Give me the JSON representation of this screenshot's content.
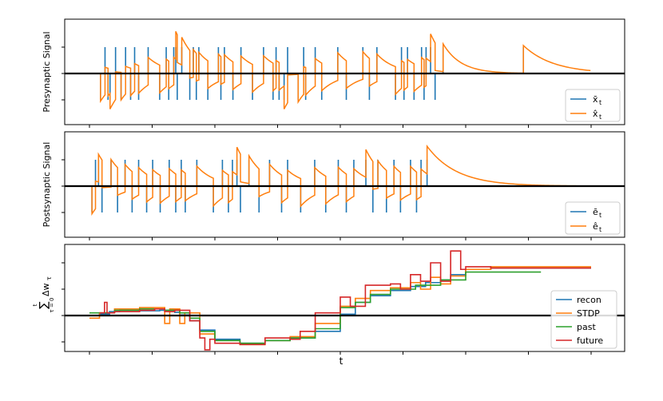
{
  "chart_data": [
    {
      "type": "line",
      "ylabel": "Presynaptic Signal",
      "legend_position": "lower-right",
      "series": [
        {
          "name": "x̄_t",
          "legend_label": "x̄",
          "legend_sub": "t",
          "color": "#1f77b4",
          "kind": "spikes",
          "x": [
            0.022,
            0.031,
            0.037,
            0.041,
            0.052,
            0.063,
            0.072,
            0.082,
            0.09,
            0.098,
            0.117,
            0.14,
            0.153,
            0.158,
            0.168,
            0.172,
            0.175,
            0.184,
            0.2,
            0.207,
            0.213,
            0.218,
            0.236,
            0.257,
            0.262,
            0.269,
            0.286,
            0.302,
            0.325,
            0.347,
            0.366,
            0.372,
            0.378,
            0.388,
            0.395,
            0.416,
            0.427,
            0.431,
            0.45,
            0.463,
            0.495,
            0.512,
            0.545,
            0.558,
            0.573,
            0.61,
            0.622,
            0.627,
            0.634,
            0.647,
            0.662,
            0.667,
            0.671,
            0.68,
            0.689,
            0.705,
            0.865
          ],
          "y": [
            -1,
            1,
            -1,
            -1,
            1,
            -1,
            1,
            -1,
            1,
            -1,
            1,
            -1,
            1,
            -1,
            1,
            1,
            -1,
            1,
            -1,
            1,
            -1,
            1,
            -1,
            1,
            -1,
            1,
            -1,
            1,
            -1,
            1,
            -1,
            1,
            -1,
            -1,
            1,
            -1,
            1,
            -1,
            1,
            -1,
            1,
            -1,
            1,
            -1,
            1,
            -1,
            1,
            -1,
            1,
            -1,
            1,
            -1,
            1,
            1,
            -1,
            1,
            1
          ]
        },
        {
          "name": "x̂_t",
          "legend_label": "x̂",
          "legend_sub": "t",
          "color": "#ff7f0e",
          "kind": "trace"
        }
      ]
    },
    {
      "type": "line",
      "ylabel": "Postsynaptic Signal",
      "legend_position": "lower-right",
      "series": [
        {
          "name": "ē_t",
          "legend_label": "ē",
          "legend_sub": "t",
          "color": "#1f77b4",
          "kind": "spikes",
          "x": [
            0.005,
            0.012,
            0.018,
            0.025,
            0.043,
            0.056,
            0.071,
            0.085,
            0.098,
            0.114,
            0.126,
            0.141,
            0.159,
            0.172,
            0.183,
            0.191,
            0.214,
            0.247,
            0.265,
            0.277,
            0.285,
            0.294,
            0.301,
            0.318,
            0.338,
            0.359,
            0.383,
            0.395,
            0.421,
            0.449,
            0.471,
            0.496,
            0.512,
            0.527,
            0.551,
            0.565,
            0.575,
            0.592,
            0.607,
            0.62,
            0.64,
            0.652,
            0.661,
            0.673
          ],
          "y": [
            -1,
            1,
            1,
            -1,
            1,
            -1,
            1,
            -1,
            1,
            -1,
            1,
            -1,
            1,
            -1,
            1,
            -1,
            1,
            -1,
            1,
            -1,
            1,
            1,
            -1,
            1,
            -1,
            1,
            -1,
            1,
            -1,
            1,
            -1,
            1,
            -1,
            1,
            1,
            -1,
            1,
            -1,
            1,
            -1,
            1,
            -1,
            1,
            1
          ]
        },
        {
          "name": "ê_t",
          "legend_label": "ê",
          "legend_sub": "t",
          "color": "#ff7f0e",
          "kind": "trace"
        }
      ]
    },
    {
      "type": "line",
      "ylabel_parts": {
        "sum": "∑",
        "upper": "t",
        "lower": "τ = 0",
        "term": "Δw",
        "term_sub": "τ"
      },
      "xlabel": "t",
      "legend_position": "lower-right",
      "ylim": [
        -1.2,
        2.4
      ],
      "series": [
        {
          "name": "recon",
          "color": "#1f77b4",
          "x": [
            0,
            0.02,
            0.04,
            0.06,
            0.1,
            0.14,
            0.17,
            0.18,
            0.2,
            0.22,
            0.25,
            0.3,
            0.35,
            0.4,
            0.45,
            0.5,
            0.53,
            0.56,
            0.6,
            0.64,
            0.67,
            0.7,
            0.72,
            0.75,
            0.8,
            0.85,
            0.9,
            0.95,
            1.0
          ],
          "y": [
            0.0,
            0.05,
            0.15,
            0.2,
            0.18,
            0.2,
            0.12,
            0.02,
            -0.2,
            -0.55,
            -0.9,
            -1.05,
            -0.95,
            -0.85,
            -0.6,
            0.05,
            0.5,
            0.75,
            0.95,
            1.1,
            1.25,
            1.35,
            1.55,
            1.75,
            1.8,
            1.8,
            1.8,
            1.8,
            1.8
          ]
        },
        {
          "name": "STDP",
          "color": "#ff7f0e",
          "x": [
            0,
            0.01,
            0.02,
            0.05,
            0.1,
            0.14,
            0.15,
            0.16,
            0.18,
            0.19,
            0.2,
            0.22,
            0.25,
            0.3,
            0.35,
            0.4,
            0.45,
            0.5,
            0.53,
            0.56,
            0.6,
            0.64,
            0.66,
            0.68,
            0.7,
            0.72,
            0.75,
            0.8,
            0.85,
            0.9,
            0.95,
            1.0
          ],
          "y": [
            -0.1,
            -0.1,
            0.1,
            0.25,
            0.3,
            0.3,
            -0.3,
            0.25,
            -0.3,
            0.1,
            0.1,
            -0.7,
            -0.95,
            -1.1,
            -0.95,
            -0.8,
            -0.3,
            0.35,
            0.65,
            0.95,
            1.05,
            1.25,
            1.0,
            1.45,
            1.2,
            1.5,
            1.75,
            1.85,
            1.85,
            1.85,
            1.85,
            1.85
          ]
        },
        {
          "name": "past",
          "color": "#2ca02c",
          "x": [
            0,
            0.02,
            0.05,
            0.1,
            0.15,
            0.18,
            0.2,
            0.22,
            0.25,
            0.3,
            0.35,
            0.4,
            0.45,
            0.5,
            0.53,
            0.56,
            0.6,
            0.65,
            0.7,
            0.75,
            0.8,
            0.85,
            0.9
          ],
          "y": [
            0.1,
            0.1,
            0.2,
            0.25,
            0.2,
            0.1,
            -0.1,
            -0.6,
            -0.95,
            -1.05,
            -0.95,
            -0.85,
            -0.5,
            0.3,
            0.5,
            0.8,
            1.0,
            1.15,
            1.35,
            1.65,
            1.65,
            1.65,
            1.65
          ]
        },
        {
          "name": "future",
          "color": "#d62728",
          "x": [
            0.02,
            0.03,
            0.035,
            0.05,
            0.1,
            0.13,
            0.15,
            0.17,
            0.2,
            0.22,
            0.23,
            0.24,
            0.25,
            0.3,
            0.35,
            0.4,
            0.42,
            0.45,
            0.5,
            0.52,
            0.55,
            0.6,
            0.62,
            0.64,
            0.66,
            0.68,
            0.7,
            0.72,
            0.74,
            0.75,
            0.8,
            0.9,
            1.0
          ],
          "y": [
            0.1,
            0.5,
            0.1,
            0.15,
            0.2,
            0.25,
            0.15,
            0.2,
            -0.2,
            -0.85,
            -1.3,
            -0.9,
            -1.05,
            -1.1,
            -0.85,
            -0.9,
            -0.6,
            0.1,
            0.7,
            0.35,
            1.15,
            1.2,
            1.0,
            1.55,
            1.3,
            2.0,
            1.3,
            2.45,
            1.75,
            1.85,
            1.8,
            1.8,
            1.8
          ]
        }
      ]
    }
  ]
}
